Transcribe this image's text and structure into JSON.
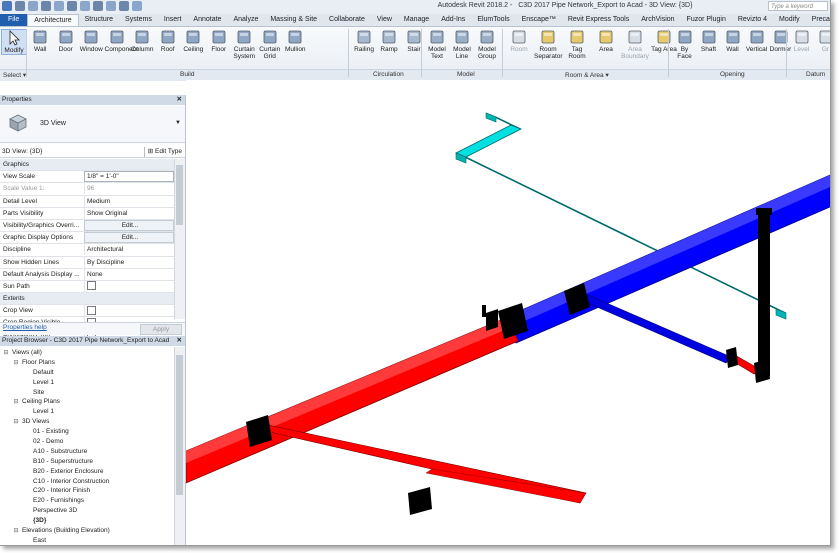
{
  "app": {
    "title": "Autodesk Revit 2018.2 -",
    "document": "C3D 2017 Pipe Network_Export to Acad - 3D View: {3D}",
    "search_placeholder": "Type a keyword"
  },
  "tabs": [
    "File",
    "Architecture",
    "Structure",
    "Systems",
    "Insert",
    "Annotate",
    "Analyze",
    "Massing & Site",
    "Collaborate",
    "View",
    "Manage",
    "Add-Ins",
    "ElumTools",
    "Enscape™",
    "Revit Express Tools",
    "ArchVision",
    "Fuzor Plugin",
    "Revizto 4",
    "Modify",
    "Precast"
  ],
  "active_tab": "Architecture",
  "ribbon": {
    "modify": "Modify",
    "select": "Select ▾",
    "build_buttons": [
      "Wall",
      "Door",
      "Window",
      "Component",
      "Column",
      "Roof",
      "Ceiling",
      "Floor",
      "Curtain System",
      "Curtain Grid",
      "Mullion"
    ],
    "circulation_buttons": [
      "Railing",
      "Ramp",
      "Stair"
    ],
    "model_buttons": [
      "Model Text",
      "Model Line",
      "Model Group"
    ],
    "room_buttons": [
      "Room",
      "Room Separator",
      "Tag Room",
      "Area",
      "Area Boundary",
      "Tag Area"
    ],
    "opening_buttons": [
      "By Face",
      "Shaft",
      "Wall",
      "Vertical",
      "Dormer"
    ],
    "datum_buttons": [
      "Level",
      "Gr"
    ],
    "panels": {
      "build": "Build",
      "circulation": "Circulation",
      "model": "Model",
      "room_area": "Room & Area ▾",
      "opening": "Opening",
      "datum": "Datum"
    }
  },
  "properties": {
    "header": "Properties",
    "type_name": "3D View",
    "view_selector": "3D View: {3D}",
    "edit_type": "Edit Type",
    "rows": [
      {
        "key": "Graphics",
        "value": "",
        "kind": "section"
      },
      {
        "key": "View Scale",
        "value": "1/8\" = 1'-0\"",
        "kind": "boxed"
      },
      {
        "key": "Scale Value    1:",
        "value": "96",
        "kind": "grey"
      },
      {
        "key": "Detail Level",
        "value": "Medium",
        "kind": "normal"
      },
      {
        "key": "Parts Visibility",
        "value": "Show Original",
        "kind": "normal"
      },
      {
        "key": "Visibility/Graphics Overri...",
        "value": "Edit...",
        "kind": "btn"
      },
      {
        "key": "Graphic Display Options",
        "value": "Edit...",
        "kind": "btn"
      },
      {
        "key": "Discipline",
        "value": "Architectural",
        "kind": "normal"
      },
      {
        "key": "Show Hidden Lines",
        "value": "By Discipline",
        "kind": "normal"
      },
      {
        "key": "Default Analysis Display ...",
        "value": "None",
        "kind": "normal"
      },
      {
        "key": "Sun Path",
        "value": "",
        "kind": "check"
      },
      {
        "key": "Extents",
        "value": "",
        "kind": "section"
      },
      {
        "key": "Crop View",
        "value": "",
        "kind": "check"
      },
      {
        "key": "Crop Region Visible",
        "value": "",
        "kind": "check"
      },
      {
        "key": "Annotation Crop",
        "value": "",
        "kind": "check"
      }
    ],
    "help_link": "Properties help",
    "apply": "Apply"
  },
  "browser": {
    "header": "Project Browser - C3D 2017 Pipe Network_Export to Acad",
    "items": [
      {
        "label": "Views (all)",
        "level": 0,
        "toggle": "⊟",
        "bold": false
      },
      {
        "label": "Floor Plans",
        "level": 1,
        "toggle": "⊟",
        "bold": false
      },
      {
        "label": "Default",
        "level": 2,
        "toggle": "",
        "bold": false
      },
      {
        "label": "Level 1",
        "level": 2,
        "toggle": "",
        "bold": false
      },
      {
        "label": "Site",
        "level": 2,
        "toggle": "",
        "bold": false
      },
      {
        "label": "Ceiling Plans",
        "level": 1,
        "toggle": "⊟",
        "bold": false
      },
      {
        "label": "Level 1",
        "level": 2,
        "toggle": "",
        "bold": false
      },
      {
        "label": "3D Views",
        "level": 1,
        "toggle": "⊟",
        "bold": false
      },
      {
        "label": "01 - Existing",
        "level": 2,
        "toggle": "",
        "bold": false
      },
      {
        "label": "02 - Demo",
        "level": 2,
        "toggle": "",
        "bold": false
      },
      {
        "label": "A10 - Substructure",
        "level": 2,
        "toggle": "",
        "bold": false
      },
      {
        "label": "B10 - Superstructure",
        "level": 2,
        "toggle": "",
        "bold": false
      },
      {
        "label": "B20 - Exterior Enclosure",
        "level": 2,
        "toggle": "",
        "bold": false
      },
      {
        "label": "C10 - Interior Construction",
        "level": 2,
        "toggle": "",
        "bold": false
      },
      {
        "label": "C20 - Interior Finish",
        "level": 2,
        "toggle": "",
        "bold": false
      },
      {
        "label": "E20 - Furnishings",
        "level": 2,
        "toggle": "",
        "bold": false
      },
      {
        "label": "Perspective 3D",
        "level": 2,
        "toggle": "",
        "bold": false
      },
      {
        "label": "{3D}",
        "level": 2,
        "toggle": "",
        "bold": true
      },
      {
        "label": "Elevations (Building Elevation)",
        "level": 1,
        "toggle": "⊟",
        "bold": false
      },
      {
        "label": "East",
        "level": 2,
        "toggle": "",
        "bold": false
      }
    ]
  },
  "colors": {
    "pipe_red": "#ff0000",
    "pipe_blue": "#0000ff",
    "pipe_cyan": "#00e5e5",
    "fitting_black": "#000000",
    "file_tab": "#1f5fae"
  }
}
